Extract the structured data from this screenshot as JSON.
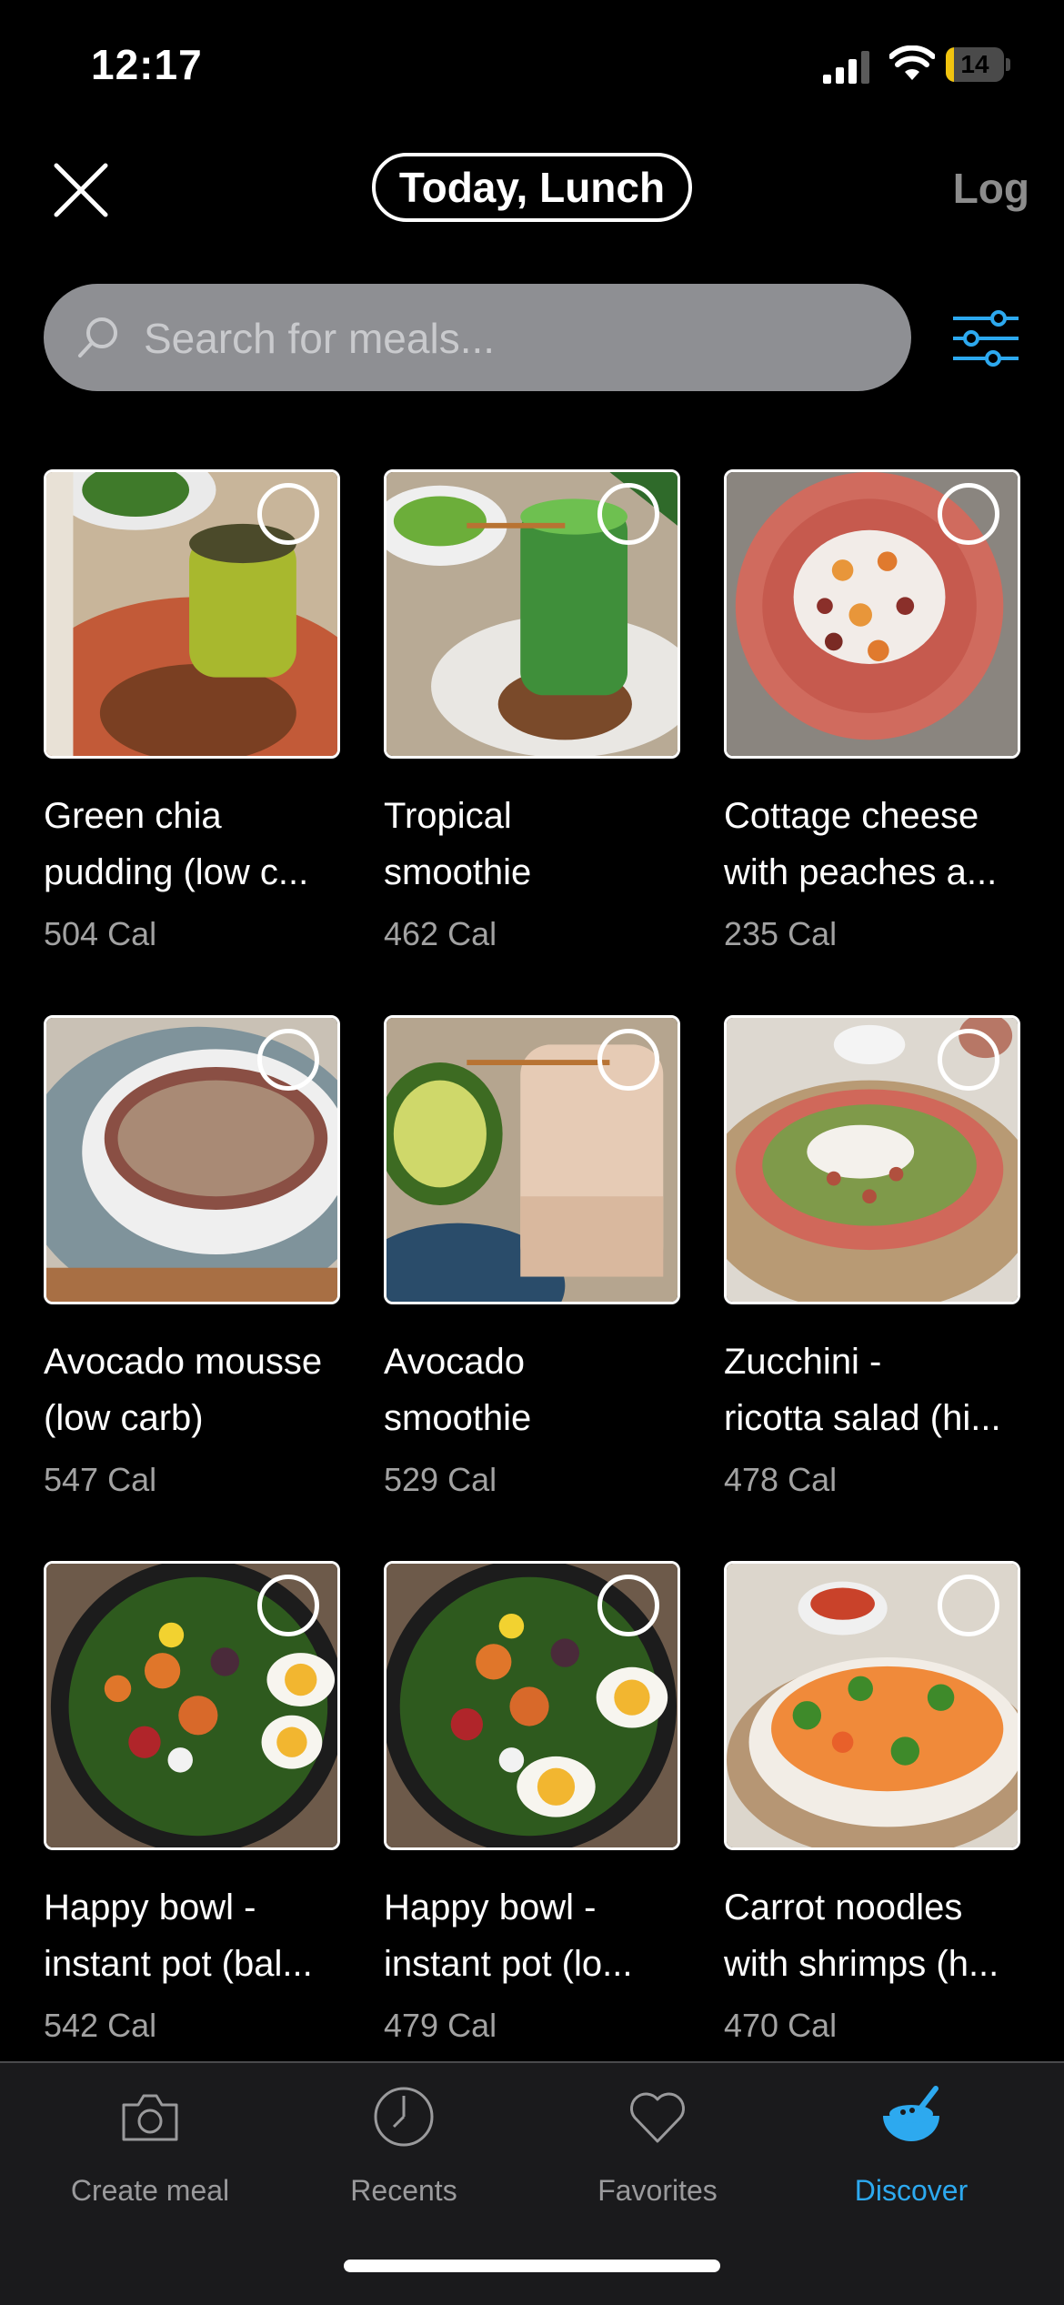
{
  "status_bar": {
    "time": "12:17",
    "battery": "14",
    "battery_level": 0.14
  },
  "header": {
    "meal_context": "Today, Lunch",
    "log_label": "Log"
  },
  "search": {
    "placeholder": "Search for meals..."
  },
  "meals": [
    {
      "line1": "Green chia",
      "line2": "pudding (low c...",
      "calories": "504 Cal",
      "image": "chia-pudding-jar"
    },
    {
      "line1": "Tropical",
      "line2": "smoothie",
      "calories": "462 Cal",
      "image": "green-smoothie-jar"
    },
    {
      "line1": "Cottage cheese",
      "line2": "with peaches a...",
      "calories": "235 Cal",
      "image": "cottage-cheese-bowl"
    },
    {
      "line1": "Avocado mousse",
      "line2": "(low carb)",
      "calories": "547 Cal",
      "image": "hemp-mousse-bowl"
    },
    {
      "line1": "Avocado",
      "line2": "smoothie",
      "calories": "529 Cal",
      "image": "avocado-smoothie-jar"
    },
    {
      "line1": "Zucchini -",
      "line2": "ricotta salad (hi...",
      "calories": "478 Cal",
      "image": "zucchini-salad-plate"
    },
    {
      "line1": "Happy bowl -",
      "line2": "instant pot (bal...",
      "calories": "542 Cal",
      "image": "sweet-potato-egg-bowl"
    },
    {
      "line1": "Happy bowl -",
      "line2": "instant pot (lo...",
      "calories": "479 Cal",
      "image": "sweet-potato-egg-bowl"
    },
    {
      "line1": "Carrot noodles",
      "line2": "with shrimps (h...",
      "calories": "470 Cal",
      "image": "carrot-shrimp-bowl"
    }
  ],
  "tabs": [
    {
      "label": "Create meal",
      "icon": "camera-icon"
    },
    {
      "label": "Recents",
      "icon": "clock-icon"
    },
    {
      "label": "Favorites",
      "icon": "heart-icon"
    },
    {
      "label": "Discover",
      "icon": "bowl-icon",
      "active": true
    }
  ],
  "colors": {
    "accent": "#2da9ef",
    "background": "#000000",
    "search_field": "#8e8f93",
    "battery": "#f1c40f"
  }
}
